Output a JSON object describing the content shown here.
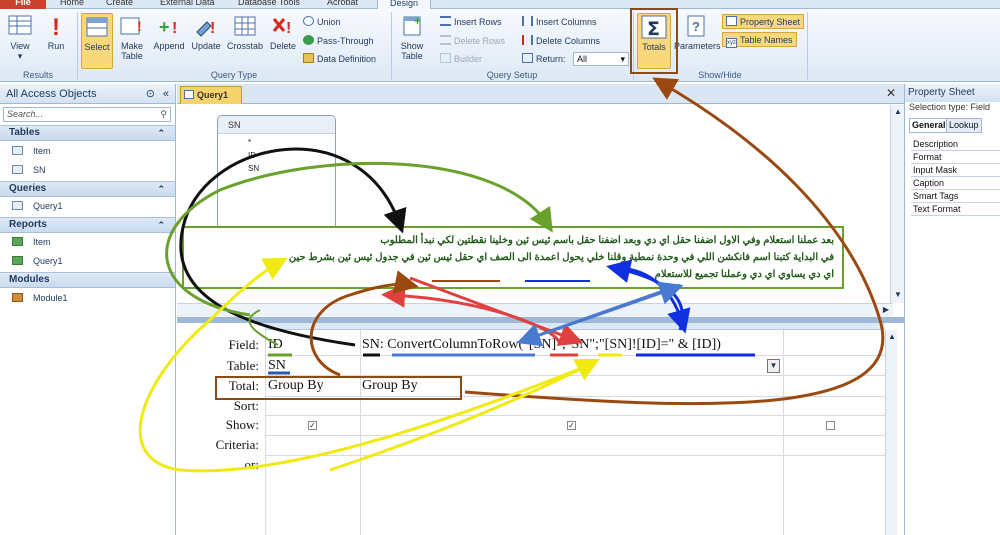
{
  "ribbon_tabs": [
    "File",
    "Home",
    "Create",
    "External Data",
    "Database Tools",
    "Acrobat",
    "Design"
  ],
  "groups": {
    "results": {
      "label": "Results",
      "view": "View",
      "run": "Run"
    },
    "query_type": {
      "label": "Query Type",
      "select": "Select",
      "make_table": "Make Table",
      "append": "Append",
      "update": "Update",
      "crosstab": "Crosstab",
      "delete": "Delete",
      "union": "Union",
      "pass_through": "Pass-Through",
      "data_definition": "Data Definition"
    },
    "query_setup": {
      "label": "Query Setup",
      "show_table": "Show Table",
      "insert_rows": "Insert Rows",
      "delete_rows": "Delete Rows",
      "builder": "Builder",
      "insert_columns": "Insert Columns",
      "delete_columns": "Delete Columns",
      "return_label": "Return:",
      "return_value": "All"
    },
    "show_hide": {
      "label": "Show/Hide",
      "totals": "Totals",
      "parameters": "Parameters",
      "property_sheet": "Property Sheet",
      "table_names": "Table Names"
    }
  },
  "nav": {
    "title": "All Access Objects",
    "search_placeholder": "Search...",
    "sections": [
      {
        "label": "Tables",
        "items": [
          "Item",
          "SN"
        ]
      },
      {
        "label": "Queries",
        "items": [
          "Query1"
        ]
      },
      {
        "label": "Reports",
        "items": [
          "Item",
          "Query1"
        ]
      },
      {
        "label": "Modules",
        "items": [
          "Module1"
        ]
      }
    ]
  },
  "document_tab": "Query1",
  "table_box": {
    "title": "SN",
    "fields": [
      "*",
      "ID",
      "SN"
    ]
  },
  "grid": {
    "row_labels": [
      "Field:",
      "Table:",
      "Total:",
      "Sort:",
      "Show:",
      "Criteria:",
      "or:"
    ],
    "col1": {
      "field": "ID",
      "table": "SN",
      "total": "Group By",
      "show": true
    },
    "col2": {
      "field": "SN: ConvertColumnToRow(\"[SN]\";\"SN\";\"[SN]![ID]=\" & [ID])",
      "total": "Group By",
      "show": true
    },
    "col3": {
      "show": false
    }
  },
  "property_sheet": {
    "title": "Property Sheet",
    "selection_type": "Selection type:  Field",
    "tabs": [
      "General",
      "Lookup"
    ],
    "rows": [
      "Description",
      "Format",
      "Input Mask",
      "Caption",
      "Smart Tags",
      "Text Format"
    ]
  },
  "annotation": {
    "lines": [
      "بعد عملنا استعلام وفي الاول اضفنا حقل اي دي وبعد اضفنا حقل باسم ئيس ئين وخلينا نقطتين لكي نبدأ المطلوب",
      "في البداية كتبنا اسم فانكشن اللي في وحدة نمطية وقلنا خلي يحول اعمدة الى الصف اي حقل ئيس ئين في جدول ئيس ئين بشرط حين",
      "اي دي يساوي اي دي وعملنا تجميع للاستعلام"
    ]
  },
  "colors": {
    "accent": "#f6d36a",
    "file_tab": "#c8432c",
    "annotation_border": "#69a12c"
  }
}
